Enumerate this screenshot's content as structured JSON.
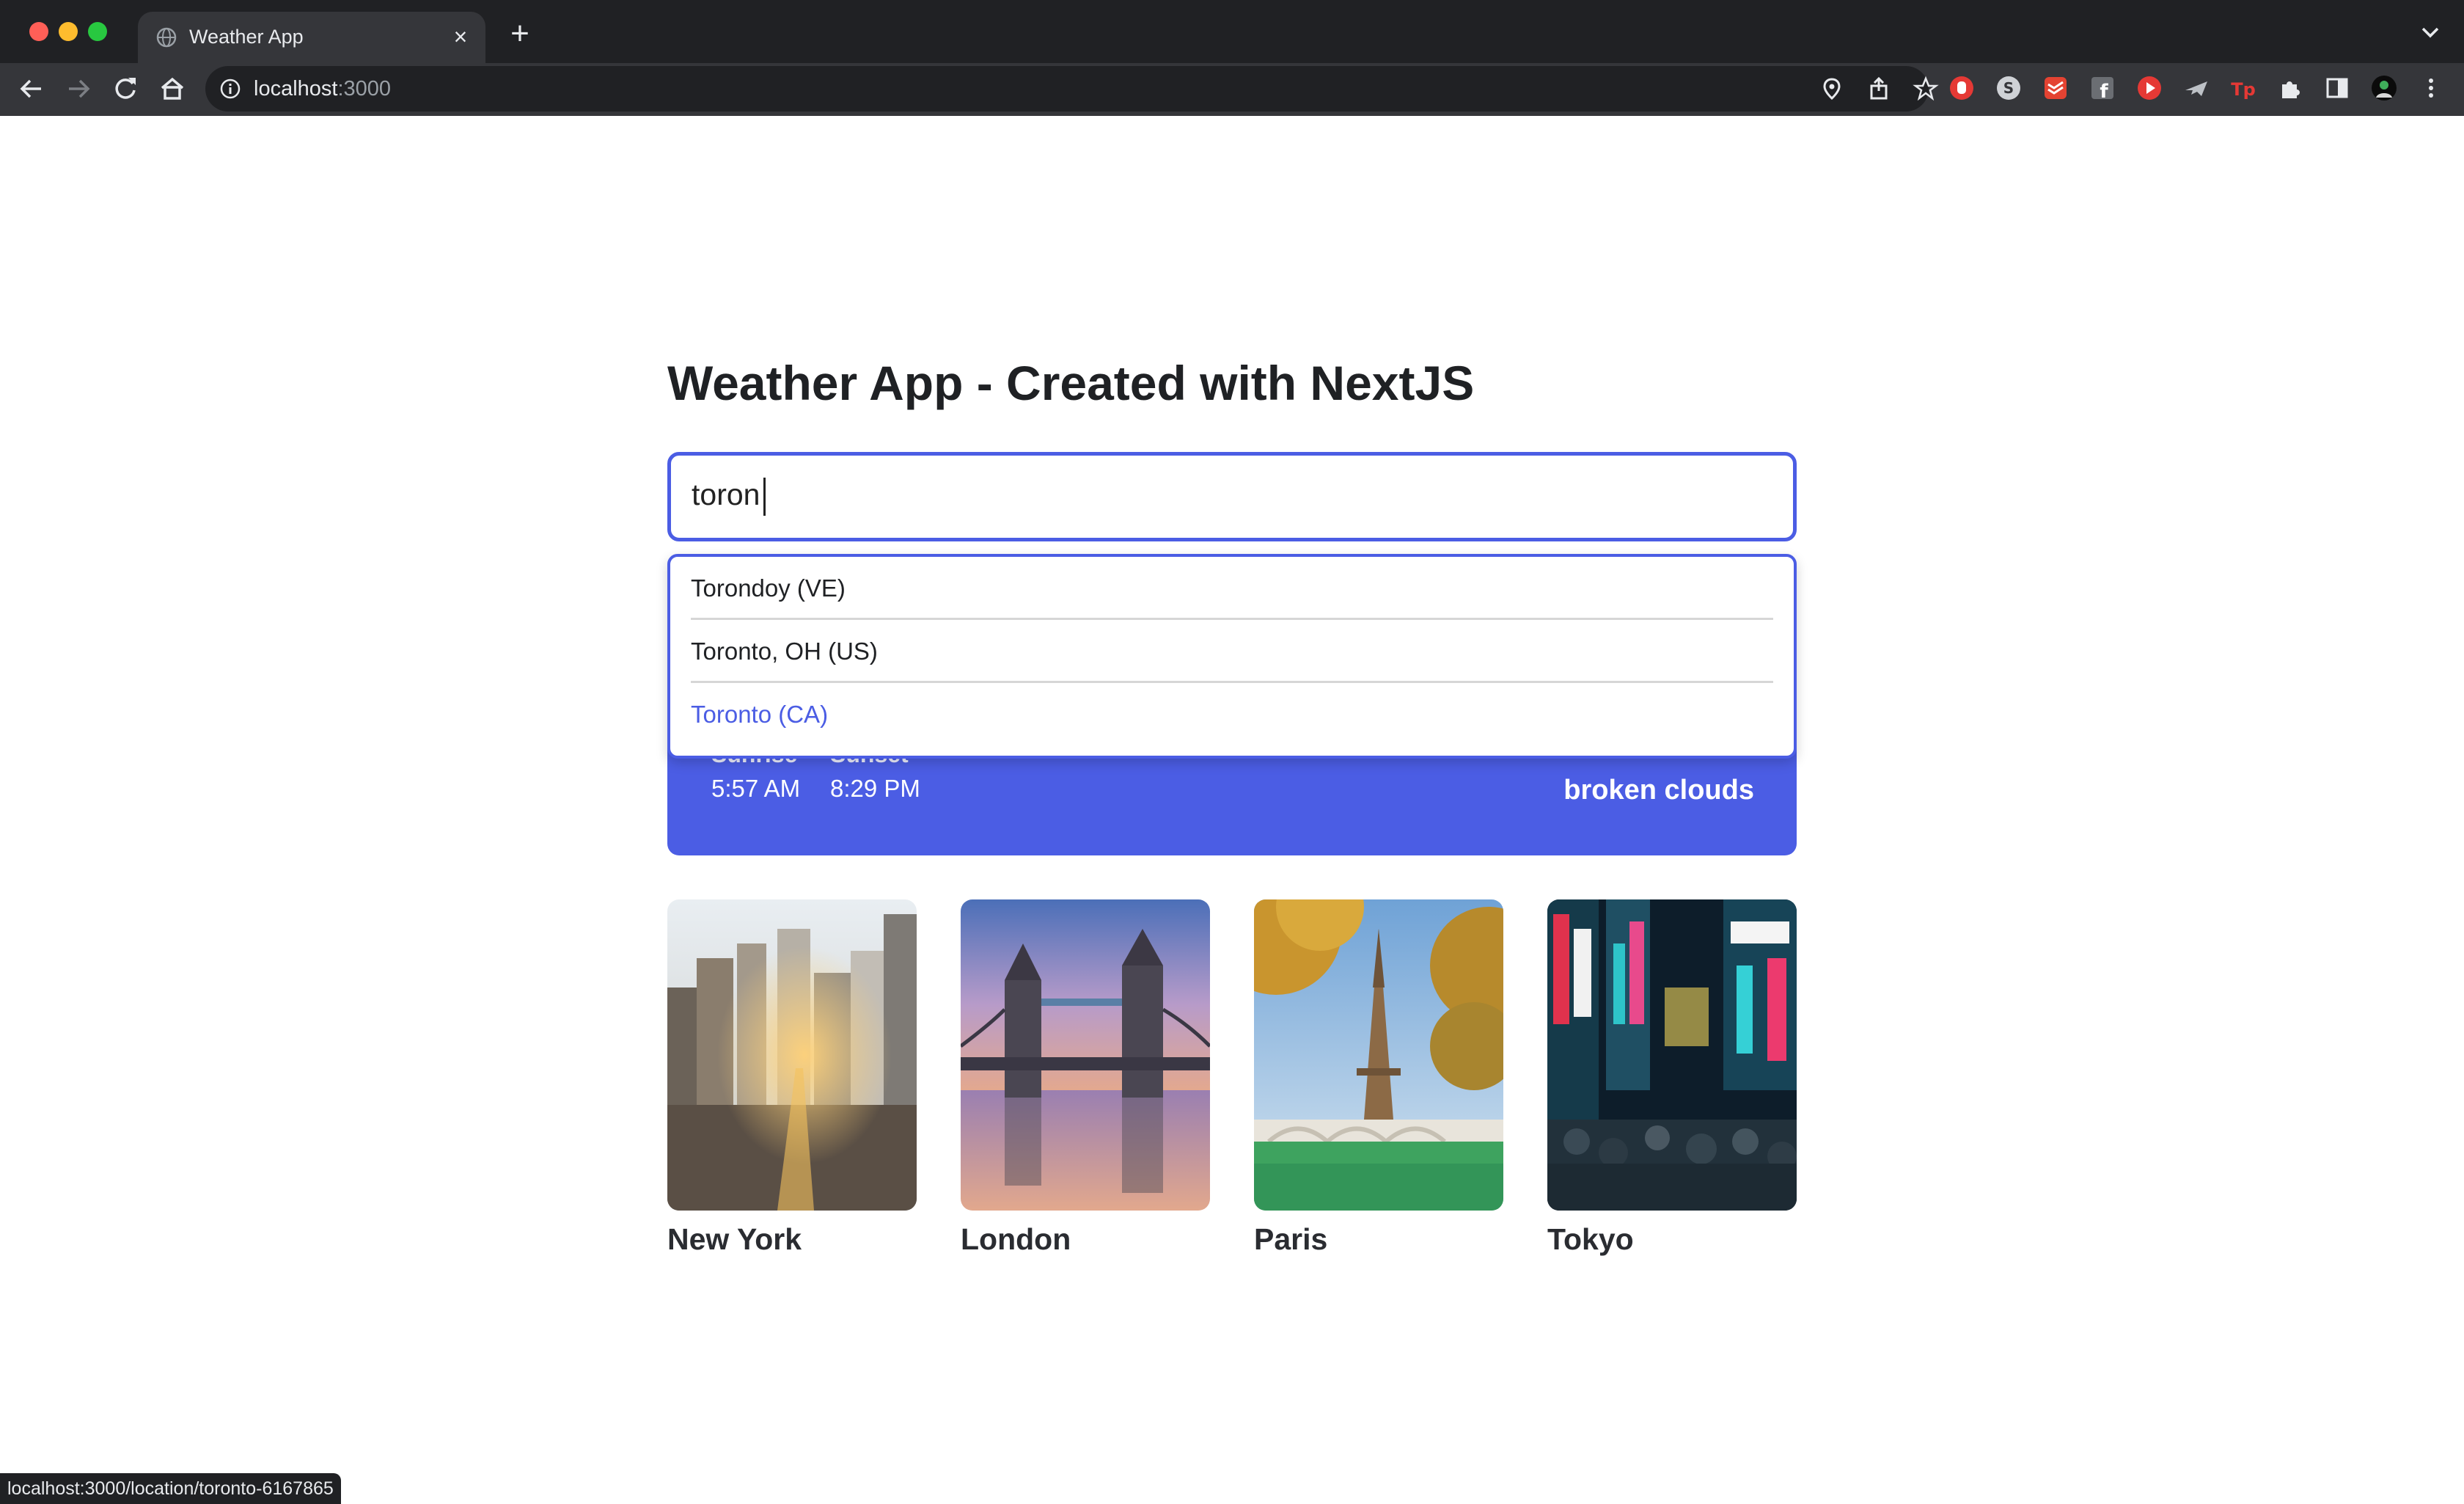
{
  "browser": {
    "tab_title": "Weather App",
    "url_host": "localhost",
    "url_port": ":3000",
    "status_url": "localhost:3000/location/toronto-6167865"
  },
  "page": {
    "title": "Weather App - Created with NextJS"
  },
  "search": {
    "value": "toron"
  },
  "suggestions": [
    {
      "label": "Torondoy (VE)"
    },
    {
      "label": "Toronto, OH (US)"
    },
    {
      "label": "Toronto (CA)"
    }
  ],
  "weather": {
    "sunrise_label": "Sunrise",
    "sunrise_value": "5:57 AM",
    "sunset_label": "Sunset",
    "sunset_value": "8:29 PM",
    "description": "broken clouds"
  },
  "cities": [
    {
      "name": "New York"
    },
    {
      "name": "London"
    },
    {
      "name": "Paris"
    },
    {
      "name": "Tokyo"
    }
  ],
  "colors": {
    "accent": "#4b5de4",
    "chrome_bg": "#35363a",
    "tabstrip_bg": "#202124"
  }
}
